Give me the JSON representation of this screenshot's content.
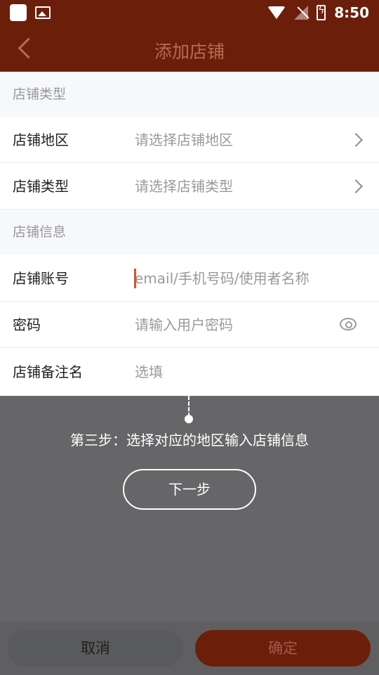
{
  "status_bar": {
    "time": "8:50"
  },
  "header": {
    "title": "添加店铺",
    "back_icon": "chevron-left-icon"
  },
  "sections": {
    "type_section": "店铺类型",
    "info_section": "店铺信息"
  },
  "rows": {
    "region": {
      "label": "店铺地区",
      "placeholder": "请选择店铺地区"
    },
    "type": {
      "label": "店铺类型",
      "placeholder": "请选择店铺类型"
    },
    "account": {
      "label": "店铺账号",
      "placeholder": "email/手机号码/使用者名称"
    },
    "password": {
      "label": "密码",
      "placeholder": "请输入用户密码"
    },
    "remark": {
      "label": "店铺备注名",
      "placeholder": "选填"
    }
  },
  "guide": {
    "text": "第三步：选择对应的地区输入店铺信息",
    "next_label": "下一步"
  },
  "footer": {
    "cancel_label": "取消",
    "confirm_label": "确定"
  },
  "colors": {
    "brand": "#6b1f0b",
    "overlay": "#666668",
    "caret": "#d9532a"
  }
}
